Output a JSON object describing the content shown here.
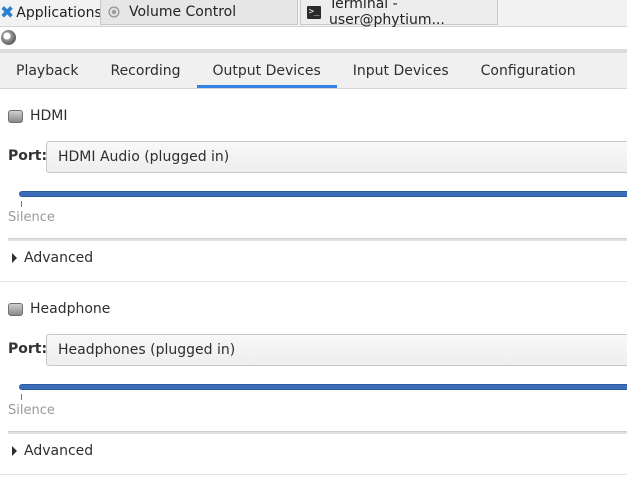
{
  "taskbar": {
    "applications_label": "Applications",
    "tasks": [
      {
        "label": "Volume Control"
      },
      {
        "label": "Terminal - user@phytium..."
      }
    ]
  },
  "tabs": [
    {
      "label": "Playback"
    },
    {
      "label": "Recording"
    },
    {
      "label": "Output Devices",
      "active": true
    },
    {
      "label": "Input Devices"
    },
    {
      "label": "Configuration"
    }
  ],
  "devices": [
    {
      "name": "HDMI",
      "port_label": "Port:",
      "port_value": "HDMI Audio (plugged in)",
      "volume_fraction": 1.0,
      "silence_label": "Silence",
      "advanced_label": "Advanced"
    },
    {
      "name": "Headphone",
      "port_label": "Port:",
      "port_value": "Headphones (plugged in)",
      "volume_fraction": 1.0,
      "silence_label": "Silence",
      "advanced_label": "Advanced"
    }
  ],
  "colors": {
    "accent": "#3584e4",
    "slider": "#3a6fb7"
  }
}
